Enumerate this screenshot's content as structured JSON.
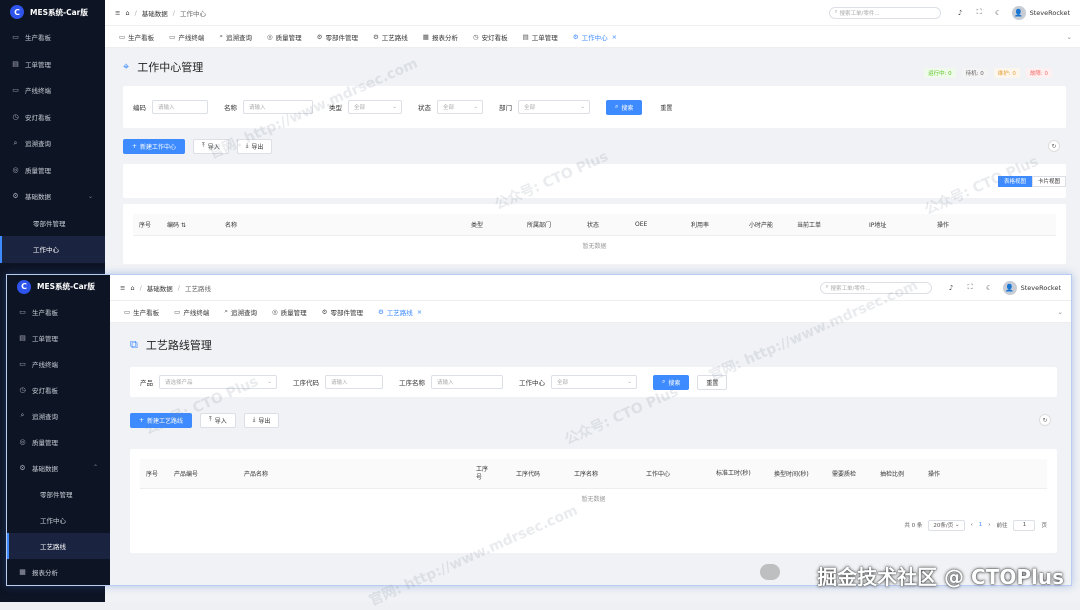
{
  "brand": "MES系统-Car版",
  "brand_mark": "C",
  "topbar": {
    "search_placeholder": "搜索工单/零件...",
    "user_name": "SteveRocket",
    "avatar_glyph": "👤"
  },
  "win1": {
    "menu": [
      {
        "label": "生产看板",
        "icon": "monitor-icon",
        "glyph": "▭"
      },
      {
        "label": "工单管理",
        "icon": "document-icon",
        "glyph": "▤"
      },
      {
        "label": "产线终端",
        "icon": "terminal-icon",
        "glyph": "▭"
      },
      {
        "label": "安灯看板",
        "icon": "alarm-icon",
        "glyph": "◷"
      },
      {
        "label": "追溯查询",
        "icon": "search-icon",
        "glyph": "⌕"
      },
      {
        "label": "质量管理",
        "icon": "check-circle-icon",
        "glyph": "◎"
      },
      {
        "label": "基础数据",
        "icon": "gear-icon",
        "glyph": "⚙"
      },
      {
        "label": "零部件管理"
      },
      {
        "label": "工作中心"
      }
    ],
    "breadcrumb": [
      "基础数据",
      "工作中心"
    ],
    "tabs": [
      {
        "label": "生产看板",
        "glyph": "▭"
      },
      {
        "label": "产线终端",
        "glyph": "▭"
      },
      {
        "label": "追溯查询",
        "glyph": "⌕"
      },
      {
        "label": "质量管理",
        "glyph": "◎"
      },
      {
        "label": "零部件管理",
        "glyph": "⚙"
      },
      {
        "label": "工艺路线",
        "glyph": "⚙"
      },
      {
        "label": "报表分析",
        "glyph": "▦"
      },
      {
        "label": "安灯看板",
        "glyph": "◷"
      },
      {
        "label": "工单管理",
        "glyph": "▤"
      },
      {
        "label": "工作中心",
        "glyph": "⚙"
      }
    ],
    "page_title": "工作中心管理",
    "status_legend": [
      {
        "label": "运行中: 0",
        "color": "#52c41a",
        "bg": "#f0faeb"
      },
      {
        "label": "待机: 0",
        "color": "#666666",
        "bg": "#f4f4f5"
      },
      {
        "label": "维护: 0",
        "color": "#e6a23c",
        "bg": "#fdf6ec"
      },
      {
        "label": "故障: 0",
        "color": "#f56c6c",
        "bg": "#fef0f0"
      }
    ],
    "filters": {
      "code_label": "编码",
      "code_placeholder": "请输入",
      "name_label": "名称",
      "name_placeholder": "请输入",
      "type_label": "类型",
      "type_value": "全部",
      "status_label": "状态",
      "status_value": "全部",
      "dept_label": "部门",
      "dept_value": "全部",
      "search_btn": "搜索",
      "reset_btn": "重置"
    },
    "actions": {
      "create": "新建工作中心",
      "import": "导入",
      "export": "导出"
    },
    "view_toggle": {
      "table": "表格视图",
      "card": "卡片视图"
    },
    "columns": [
      "序号",
      "编码",
      "名称",
      "类型",
      "所属部门",
      "状态",
      "OEE",
      "利用率",
      "小时产能",
      "当前工单",
      "IP地址",
      "操作"
    ],
    "empty_text": "暂无数据"
  },
  "win2": {
    "menu": [
      {
        "label": "生产看板",
        "icon": "monitor-icon",
        "glyph": "▭"
      },
      {
        "label": "工单管理",
        "icon": "document-icon",
        "glyph": "▤"
      },
      {
        "label": "产线终端",
        "icon": "terminal-icon",
        "glyph": "▭"
      },
      {
        "label": "安灯看板",
        "icon": "alarm-icon",
        "glyph": "◷"
      },
      {
        "label": "追溯查询",
        "icon": "search-icon",
        "glyph": "⌕"
      },
      {
        "label": "质量管理",
        "icon": "check-circle-icon",
        "glyph": "◎"
      },
      {
        "label": "基础数据",
        "icon": "gear-icon",
        "glyph": "⚙"
      },
      {
        "label": "零部件管理"
      },
      {
        "label": "工作中心"
      },
      {
        "label": "工艺路线"
      },
      {
        "label": "报表分析",
        "icon": "chart-icon",
        "glyph": "▦"
      }
    ],
    "breadcrumb": [
      "基础数据",
      "工艺路线"
    ],
    "tabs": [
      {
        "label": "生产看板",
        "glyph": "▭"
      },
      {
        "label": "产线终端",
        "glyph": "▭"
      },
      {
        "label": "追溯查询",
        "glyph": "⌕"
      },
      {
        "label": "质量管理",
        "glyph": "◎"
      },
      {
        "label": "零部件管理",
        "glyph": "⚙"
      },
      {
        "label": "工艺路线",
        "glyph": "⚙"
      }
    ],
    "page_title": "工艺路线管理",
    "filters": {
      "product_label": "产品",
      "product_placeholder": "请选择产品",
      "op_code_label": "工序代码",
      "op_code_placeholder": "请输入",
      "op_name_label": "工序名称",
      "op_name_placeholder": "请输入",
      "wc_label": "工作中心",
      "wc_value": "全部",
      "search_btn": "搜索",
      "reset_btn": "重置"
    },
    "actions": {
      "create": "新建工艺路线",
      "import": "导入",
      "export": "导出"
    },
    "columns": [
      "序号",
      "产品编号",
      "产品名称",
      "工序号",
      "工序代码",
      "工序名称",
      "工作中心",
      "标准工时(秒)",
      "换型时间(秒)",
      "需要质检",
      "抽检比例",
      "操作"
    ],
    "empty_text": "暂无数据",
    "pager": {
      "total": "共 0 条",
      "size": "20条/页",
      "page": "1",
      "goto_label": "前往",
      "goto_value": "1",
      "page_unit": "页"
    }
  },
  "watermark_texts": [
    "官网: http://www.mdrsec.com",
    "公众号: CTO Plus"
  ],
  "caption": "掘金技术社区 @ CTOPlus"
}
